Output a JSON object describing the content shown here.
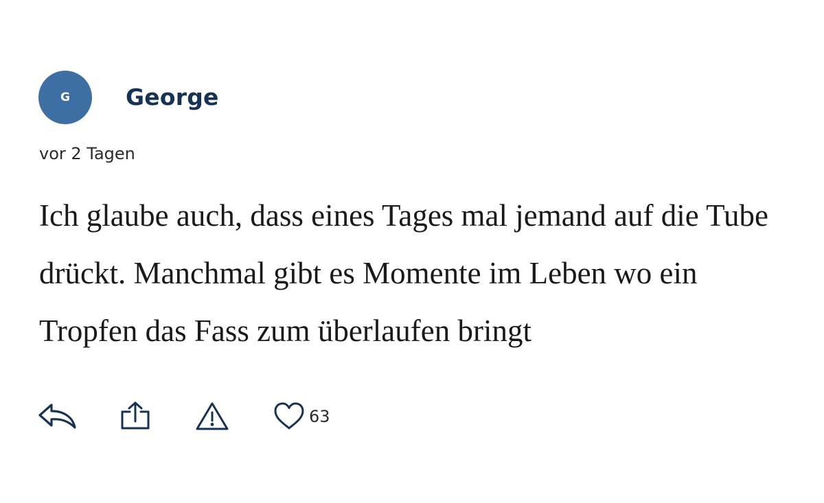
{
  "colors": {
    "avatar_bg": "#3d6fa5",
    "username": "#163254",
    "icon": "#163254"
  },
  "comment": {
    "avatar_initial": "G",
    "username": "George",
    "timestamp": "vor 2 Tagen",
    "text": "Ich glaube auch, dass eines Tages mal jemand auf die Tube drückt. Manchmal gibt es Momente im Leben wo ein Tropfen das Fass zum überlaufen bringt"
  },
  "actions": {
    "reply_icon": "reply-arrow-icon",
    "share_icon": "share-upload-icon",
    "report_icon": "warning-triangle-icon",
    "like_icon": "heart-outline-icon",
    "like_count": "63"
  }
}
